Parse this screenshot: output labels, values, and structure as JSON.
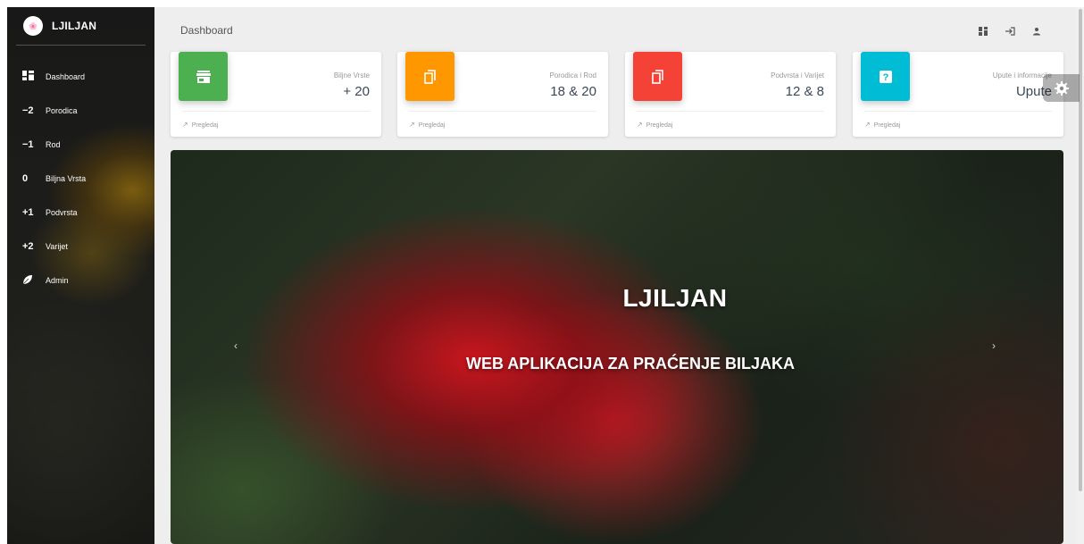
{
  "brand": {
    "logo_text": "🌸",
    "name": "LJILJAN"
  },
  "sidebar": {
    "items": [
      {
        "icon": "dashboard-icon",
        "symbol": "▦",
        "label": "Dashboard"
      },
      {
        "icon": "minus-two-icon",
        "symbol": "−2",
        "label": "Porodica"
      },
      {
        "icon": "minus-one-icon",
        "symbol": "−1",
        "label": "Rod"
      },
      {
        "icon": "zero-icon",
        "symbol": "0",
        "label": "Biljna Vrsta"
      },
      {
        "icon": "plus-one-icon",
        "symbol": "+1",
        "label": "Podvrsta"
      },
      {
        "icon": "plus-two-icon",
        "symbol": "+2",
        "label": "Varijet"
      },
      {
        "icon": "leaf-icon",
        "symbol": "",
        "label": "Admin"
      }
    ]
  },
  "header": {
    "title": "Dashboard",
    "actions": [
      {
        "icon": "dashboard-grid-icon"
      },
      {
        "icon": "login-icon"
      },
      {
        "icon": "person-icon"
      }
    ]
  },
  "cards": [
    {
      "category": "Biljne Vrste",
      "value": "+ 20",
      "footer": "Pregledaj",
      "icon": "store-icon",
      "color": "#4caf50"
    },
    {
      "category": "Porodica i Rod",
      "value": "18 & 20",
      "footer": "Pregledaj",
      "icon": "copy-icon",
      "color": "#ff9800"
    },
    {
      "category": "Podvrsta i Varijet",
      "value": "12 & 8",
      "footer": "Pregledaj",
      "icon": "copy-icon",
      "color": "#f44336"
    },
    {
      "category": "Upute i informacije",
      "value": "Upute",
      "footer": "Pregledaj",
      "icon": "help-icon",
      "color": "#00bcd4"
    }
  ],
  "hero": {
    "title": "LJILJAN",
    "subtitle": "WEB APLIKACIJA ZA PRAĆENJE BILJAKA",
    "prev_symbol": "‹",
    "next_symbol": "›"
  },
  "settings": {
    "icon": "gear-icon"
  }
}
